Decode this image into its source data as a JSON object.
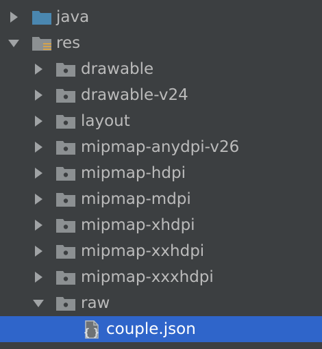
{
  "project_tree": {
    "java": {
      "label": "java",
      "expanded": false,
      "icon": "source-folder-icon",
      "color": "#4a87b0"
    },
    "res": {
      "label": "res",
      "expanded": true,
      "icon": "resource-folder-icon"
    },
    "res_children": [
      {
        "label": "drawable",
        "expanded": false
      },
      {
        "label": "drawable-v24",
        "expanded": false
      },
      {
        "label": "layout",
        "expanded": false
      },
      {
        "label": "mipmap-anydpi-v26",
        "expanded": false
      },
      {
        "label": "mipmap-hdpi",
        "expanded": false
      },
      {
        "label": "mipmap-mdpi",
        "expanded": false
      },
      {
        "label": "mipmap-xhdpi",
        "expanded": false
      },
      {
        "label": "mipmap-xxhdpi",
        "expanded": false
      },
      {
        "label": "mipmap-xxxhdpi",
        "expanded": false
      },
      {
        "label": "raw",
        "expanded": true
      }
    ],
    "raw_children": [
      {
        "label": "couple.json",
        "selected": true,
        "icon": "json-file-icon"
      }
    ]
  },
  "colors": {
    "background": "#3c3f41",
    "text": "#bbbbbb",
    "selection": "#2f65ca",
    "folder": "#8c9092",
    "source_folder": "#4a87b0"
  }
}
